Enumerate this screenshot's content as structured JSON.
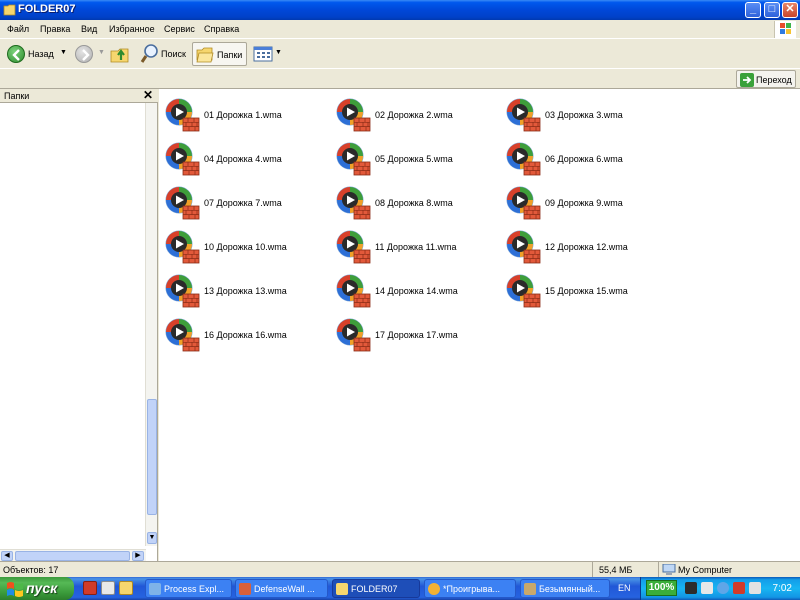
{
  "window": {
    "title": "FOLDER07",
    "buttons": {
      "minimize": "_",
      "maximize": "□",
      "close": "✕"
    }
  },
  "menu": [
    "Файл",
    "Правка",
    "Вид",
    "Избранное",
    "Сервис",
    "Справка"
  ],
  "toolbar": {
    "back_label": "Назад",
    "search_label": "Поиск",
    "folders_label": "Папки"
  },
  "address": {
    "go_label": "Переход"
  },
  "folders_pane": {
    "title": "Папки",
    "close": "✕"
  },
  "files": [
    {
      "name": "01 Дорожка 1.wma"
    },
    {
      "name": "02 Дорожка 2.wma"
    },
    {
      "name": "03 Дорожка 3.wma"
    },
    {
      "name": "04 Дорожка 4.wma"
    },
    {
      "name": "05 Дорожка 5.wma"
    },
    {
      "name": "06 Дорожка 6.wma"
    },
    {
      "name": "07 Дорожка 7.wma"
    },
    {
      "name": "08 Дорожка 8.wma"
    },
    {
      "name": "09 Дорожка 9.wma"
    },
    {
      "name": "10 Дорожка 10.wma"
    },
    {
      "name": "11 Дорожка 11.wma"
    },
    {
      "name": "12 Дорожка 12.wma"
    },
    {
      "name": "13 Дорожка 13.wma"
    },
    {
      "name": "14 Дорожка 14.wma"
    },
    {
      "name": "15 Дорожка 15.wma"
    },
    {
      "name": "16 Дорожка 16.wma"
    },
    {
      "name": "17 Дорожка 17.wma"
    }
  ],
  "status": {
    "objects": "Объектов: 17",
    "size": "55,4 МБ",
    "location": "My Computer"
  },
  "taskbar": {
    "start_label": "пуск",
    "tasks": [
      {
        "label": "Process Expl...",
        "active": false
      },
      {
        "label": "DefenseWall ...",
        "active": false
      },
      {
        "label": "FOLDER07",
        "active": true
      },
      {
        "label": "*Проигрыва...",
        "active": false
      },
      {
        "label": "Безымянный...",
        "active": false
      }
    ],
    "language": "EN",
    "zoom": "100%",
    "clock": "7:02"
  },
  "colors": {
    "title_blue": "#0047D8",
    "start_green": "#3A9A3A",
    "taskbar_blue": "#2157D7",
    "tray_blue": "#18B5F2"
  }
}
